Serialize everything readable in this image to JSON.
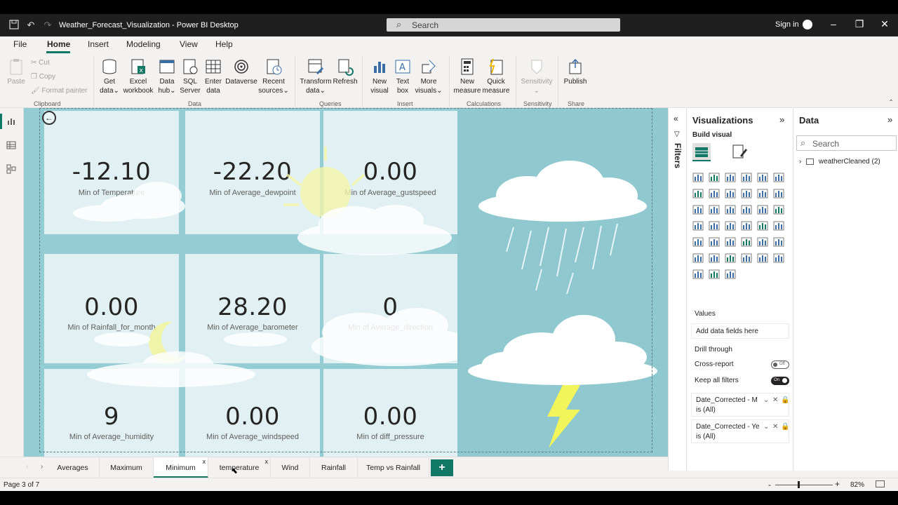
{
  "titlebar": {
    "title": "Weather_Forecast_Visualization - Power BI Desktop",
    "search_placeholder": "Search",
    "signin_label": "Sign in"
  },
  "menu": {
    "items": [
      "File",
      "Home",
      "Insert",
      "Modeling",
      "View",
      "Help"
    ],
    "active": "Home"
  },
  "ribbon": {
    "clipboard": {
      "paste": "Paste",
      "cut": "Cut",
      "copy": "Copy",
      "format_painter": "Format painter",
      "group": "Clipboard"
    },
    "data": {
      "get_data": [
        "Get",
        "data"
      ],
      "excel": [
        "Excel",
        "workbook"
      ],
      "data_hub": [
        "Data",
        "hub"
      ],
      "sql": [
        "SQL",
        "Server"
      ],
      "enter_data": [
        "Enter",
        "data"
      ],
      "dataverse": "Dataverse",
      "recent": [
        "Recent",
        "sources"
      ],
      "group": "Data"
    },
    "queries": {
      "transform": [
        "Transform",
        "data"
      ],
      "refresh": "Refresh",
      "group": "Queries"
    },
    "insert": {
      "new_visual": [
        "New",
        "visual"
      ],
      "text_box": [
        "Text",
        "box"
      ],
      "more_visuals": [
        "More",
        "visuals"
      ],
      "group": "Insert"
    },
    "calculations": {
      "new_measure": [
        "New",
        "measure"
      ],
      "quick_measure": [
        "Quick",
        "measure"
      ],
      "group": "Calculations"
    },
    "sensitivity": {
      "label": "Sensitivity",
      "group": "Sensitivity"
    },
    "share": {
      "publish": "Publish",
      "group": "Share"
    }
  },
  "kpis": [
    {
      "value": "-12.10",
      "label": "Min of Temperature"
    },
    {
      "value": "-22.20",
      "label": "Min of Average_dewpoint"
    },
    {
      "value": "0.00",
      "label": "Min of Average_gustspeed"
    },
    {
      "value": "0.00",
      "label": "Min of Rainfall_for_month"
    },
    {
      "value": "28.20",
      "label": "Min of Average_barometer"
    },
    {
      "value": "0",
      "label": "Min of Average_direction"
    },
    {
      "value": "9",
      "label": "Min of Average_humidity"
    },
    {
      "value": "0.00",
      "label": "Min of Average_windspeed"
    },
    {
      "value": "0.00",
      "label": "Min of diff_pressure"
    }
  ],
  "filters_pane": {
    "label": "Filters"
  },
  "visualizations": {
    "title": "Visualizations",
    "build_visual": "Build visual",
    "values_label": "Values",
    "add_fields": "Add data fields here",
    "drill_through": "Drill through",
    "cross_report": "Cross-report",
    "cross_report_state": "Off",
    "keep_filters": "Keep all filters",
    "keep_filters_state": "On",
    "filter_cards": [
      {
        "field": "Date_Corrected - M",
        "state": "is (All)"
      },
      {
        "field": "Date_Corrected - Ye",
        "state": "is (All)"
      }
    ]
  },
  "data_pane": {
    "title": "Data",
    "search_placeholder": "Search",
    "table": "weatherCleaned (2)"
  },
  "tabs": [
    {
      "label": "Averages",
      "active": false
    },
    {
      "label": "Maximum",
      "active": false
    },
    {
      "label": "Minimum",
      "active": true
    },
    {
      "label": "temperature",
      "active": false
    },
    {
      "label": "Wind",
      "active": false
    },
    {
      "label": "Rainfall",
      "active": false
    },
    {
      "label": "Temp vs Rainfall",
      "active": false
    }
  ],
  "tab_close": "x",
  "add_tab": "+",
  "status": {
    "page": "Page 3 of 7",
    "zoom": "82%"
  },
  "colors": {
    "accent": "#117865",
    "canvas": "#93ccd2",
    "tile": "#e1f1f3"
  }
}
